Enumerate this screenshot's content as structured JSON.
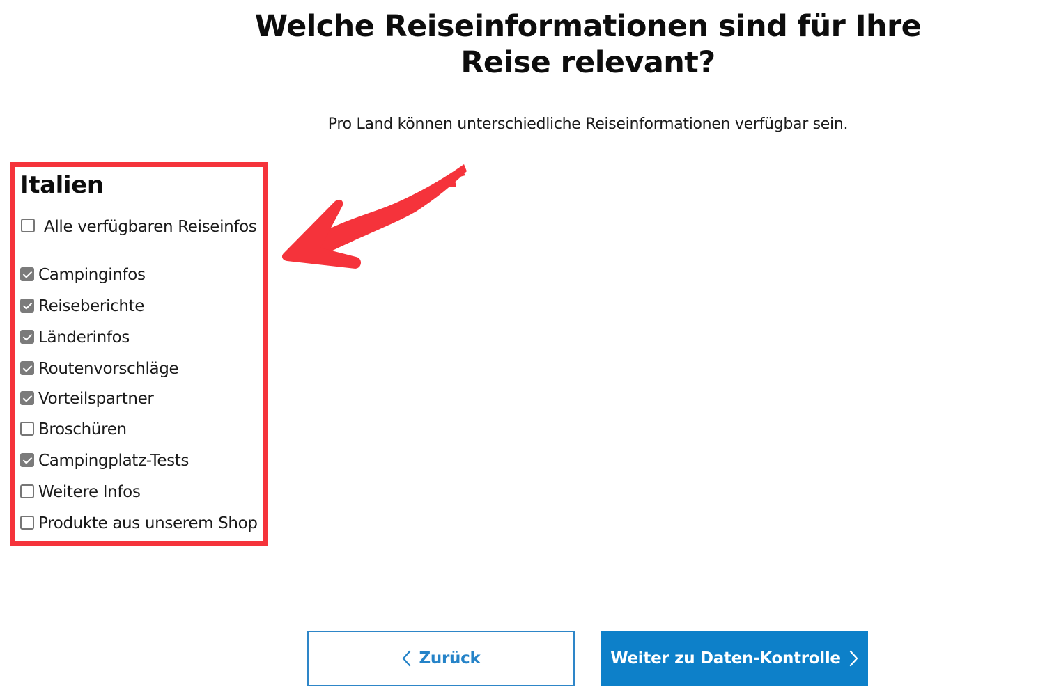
{
  "page": {
    "title": "Welche Reiseinformationen sind für Ihre Reise relevant?",
    "subtitle": "Pro Land können unterschiedliche Reiseinformationen verfügbar sein."
  },
  "country": {
    "name": "Italien",
    "select_all": {
      "label": "Alle verfügbaren Reiseinfos",
      "checked": false
    },
    "options": [
      {
        "label": "Campinginfos",
        "checked": true
      },
      {
        "label": "Reiseberichte",
        "checked": true
      },
      {
        "label": "Länderinfos",
        "checked": true
      },
      {
        "label": "Routenvorschläge",
        "checked": true
      },
      {
        "label": "Vorteilspartner",
        "checked": true
      },
      {
        "label": "Broschüren",
        "checked": false
      },
      {
        "label": "Campingplatz-Tests",
        "checked": true
      },
      {
        "label": "Weitere Infos",
        "checked": false
      },
      {
        "label": "Produkte aus unserem Shop",
        "checked": false
      }
    ]
  },
  "buttons": {
    "back": {
      "label": "Zurück",
      "icon": "chevron-left-icon"
    },
    "next": {
      "label": "Weiter zu Daten-Kontrolle",
      "icon": "chevron-right-icon"
    }
  },
  "colors": {
    "highlight": "#f5333b",
    "primary": "#0d80c9",
    "checkbox_checked": "#7b7b7b"
  }
}
